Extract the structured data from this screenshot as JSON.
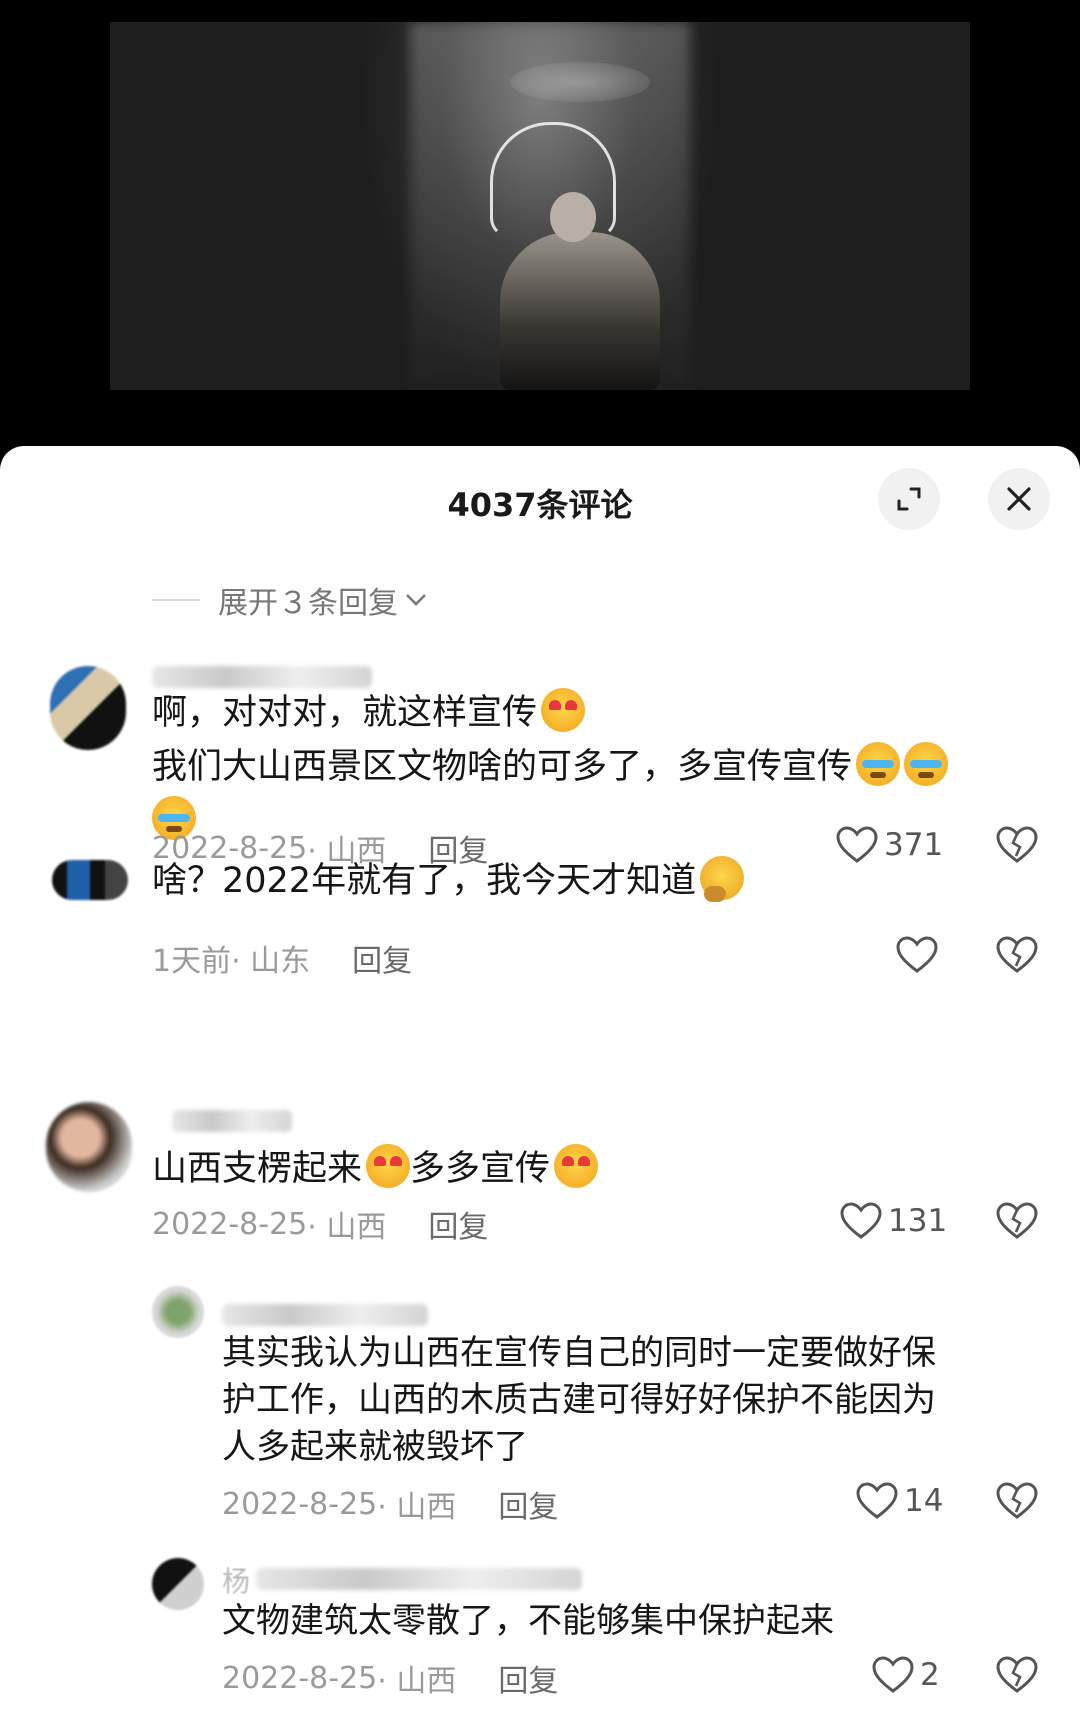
{
  "panel": {
    "title": "4037条评论"
  },
  "expand_replies": {
    "label": "展开３条回复"
  },
  "comments": [
    {
      "line1": "啊，对对对，就这样宣传",
      "line2": "我们大山西景区文物啥的可多了，多宣传宣传",
      "date": "2022-8-25",
      "location": "· 山西",
      "reply": "回复",
      "likes": "371",
      "emojis": [
        "heart-eyes-emoji",
        "crying-emoji",
        "crying-emoji",
        "crying-emoji"
      ]
    },
    {
      "line1": "啥？2022年就有了，我今天才知道",
      "date": "1天前",
      "location": "· 山东",
      "reply": "回复",
      "likes": "",
      "emojis": [
        "thinking-emoji"
      ]
    },
    {
      "line1": "山西支楞起来",
      "line1b": "多多宣传",
      "date": "2022-8-25",
      "location": "· 山西",
      "reply": "回复",
      "likes": "131",
      "emojis": [
        "heart-eyes-emoji",
        "heart-eyes-emoji"
      ]
    },
    {
      "line1": "其实我认为山西在宣传自己的同时一定要做好保",
      "line2": "护工作，山西的木质古建可得好好保护不能因为",
      "line3": "人多起来就被毁坏了",
      "date": "2022-8-25",
      "location": "· 山西",
      "reply": "回复",
      "likes": "14"
    },
    {
      "name_visible": "杨",
      "line1": "文物建筑太零散了，不能够集中保护起来",
      "date": "2022-8-25",
      "location": "· 山西",
      "reply": "回复",
      "likes": "2"
    }
  ],
  "icons": {
    "expand": "expand-icon",
    "close": "close-icon",
    "like": "heart-outline-icon",
    "dislike": "broken-heart-icon",
    "chevron": "chevron-down-icon"
  }
}
